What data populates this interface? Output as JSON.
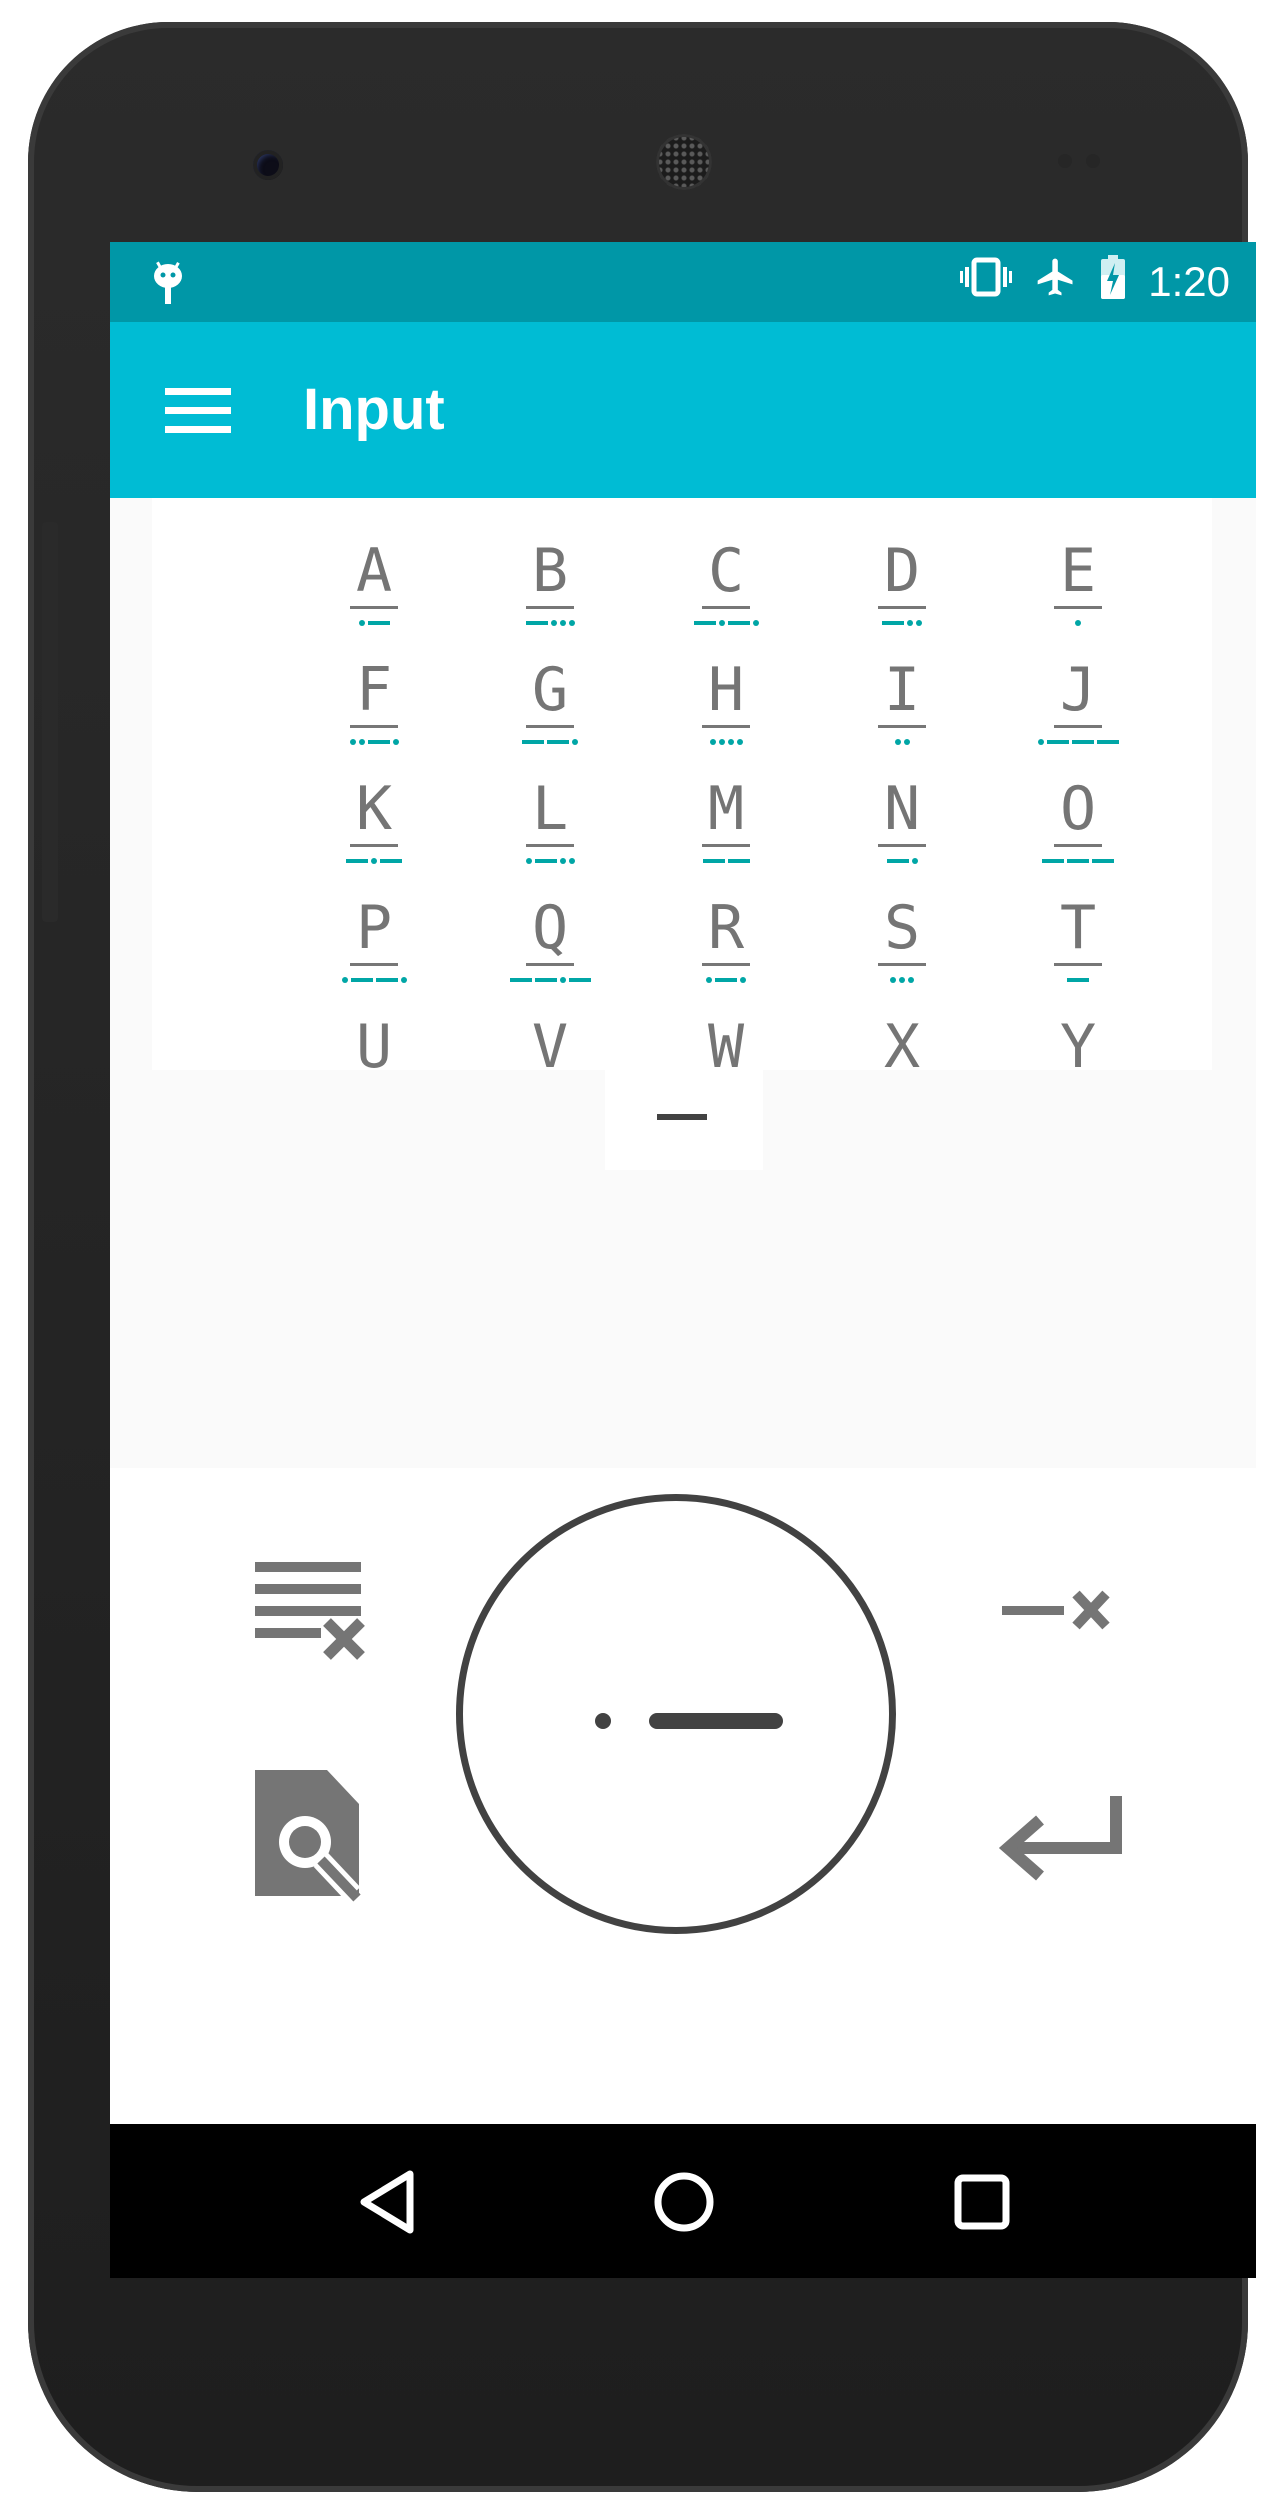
{
  "status_bar": {
    "time": "1:20",
    "icons": [
      "android-debug-icon",
      "vibrate-icon",
      "airplane-mode-icon",
      "battery-charging-icon"
    ]
  },
  "app_bar": {
    "title": "Input",
    "menu_icon": "menu-icon"
  },
  "morse_table": [
    {
      "letter": "A",
      "code": ".-"
    },
    {
      "letter": "B",
      "code": "-..."
    },
    {
      "letter": "C",
      "code": "-.-."
    },
    {
      "letter": "D",
      "code": "-.."
    },
    {
      "letter": "E",
      "code": "."
    },
    {
      "letter": "F",
      "code": "..-."
    },
    {
      "letter": "G",
      "code": "--."
    },
    {
      "letter": "H",
      "code": "...."
    },
    {
      "letter": "I",
      "code": ".."
    },
    {
      "letter": "J",
      "code": ".---"
    },
    {
      "letter": "K",
      "code": "-.-"
    },
    {
      "letter": "L",
      "code": ".-.."
    },
    {
      "letter": "M",
      "code": "--"
    },
    {
      "letter": "N",
      "code": "-."
    },
    {
      "letter": "O",
      "code": "---"
    },
    {
      "letter": "P",
      "code": ".--."
    },
    {
      "letter": "Q",
      "code": "--.-"
    },
    {
      "letter": "R",
      "code": ".-."
    },
    {
      "letter": "S",
      "code": "..."
    },
    {
      "letter": "T",
      "code": "-"
    },
    {
      "letter": "U",
      "code": ""
    },
    {
      "letter": "V",
      "code": ""
    },
    {
      "letter": "W",
      "code": ""
    },
    {
      "letter": "X",
      "code": ""
    },
    {
      "letter": "Y",
      "code": ""
    }
  ],
  "keyboard": {
    "clear_icon": "clear-all-icon",
    "lookup_icon": "document-search-icon",
    "key_icon": "dot-dash-icon",
    "backspace_icon": "dash-delete-icon",
    "enter_icon": "enter-return-icon"
  },
  "navigation": [
    "back-icon",
    "home-icon",
    "recents-icon"
  ],
  "colors": {
    "status_bar": "#0097a7",
    "app_bar": "#00bcd4",
    "morse_accent": "#00a6a6",
    "icon_gray": "#757575"
  }
}
